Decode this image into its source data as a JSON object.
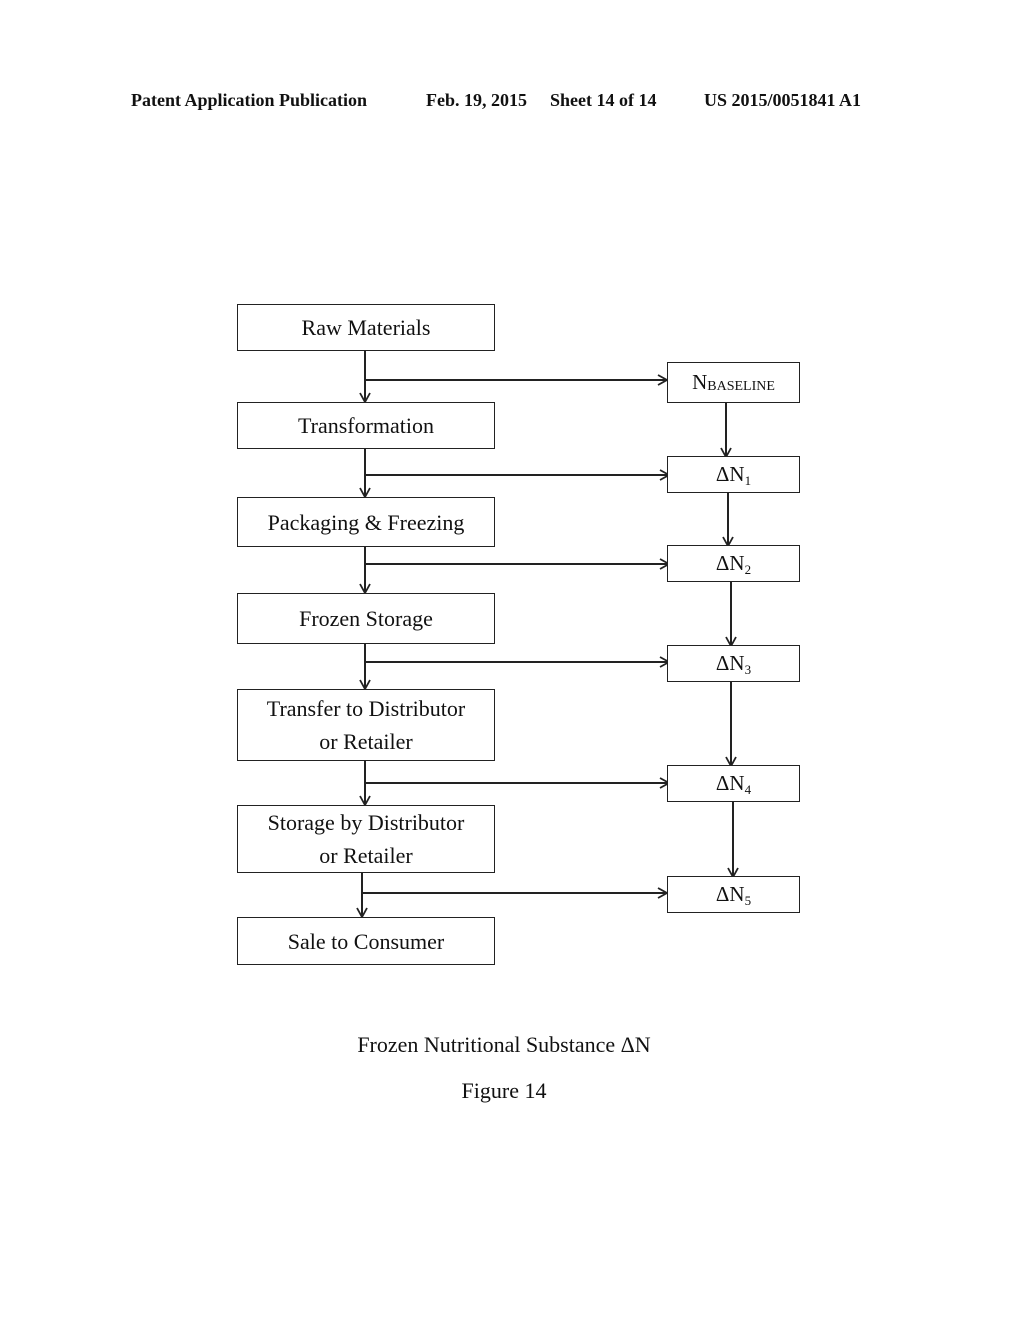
{
  "header": {
    "publication": "Patent Application Publication",
    "date": "Feb. 19, 2015",
    "sheet": "Sheet 14 of 14",
    "number": "US 2015/0051841 A1"
  },
  "flow": {
    "steps": [
      {
        "label": "Raw Materials"
      },
      {
        "label": "Transformation"
      },
      {
        "label": "Packaging & Freezing"
      },
      {
        "label": "Frozen Storage"
      },
      {
        "label": "Transfer to Distributor",
        "label2": "or Retailer"
      },
      {
        "label": "Storage by Distributor",
        "label2": "or Retailer"
      },
      {
        "label": "Sale to Consumer"
      }
    ],
    "nutrition": [
      {
        "main": "N",
        "sub": "BASELINE"
      },
      {
        "main": "ΔN",
        "sub": "1"
      },
      {
        "main": "ΔN",
        "sub": "2"
      },
      {
        "main": "ΔN",
        "sub": "3"
      },
      {
        "main": "ΔN",
        "sub": "4"
      },
      {
        "main": "ΔN",
        "sub": "5"
      }
    ]
  },
  "caption": {
    "title": "Frozen Nutritional Substance ΔN",
    "figure": "Figure 14"
  }
}
